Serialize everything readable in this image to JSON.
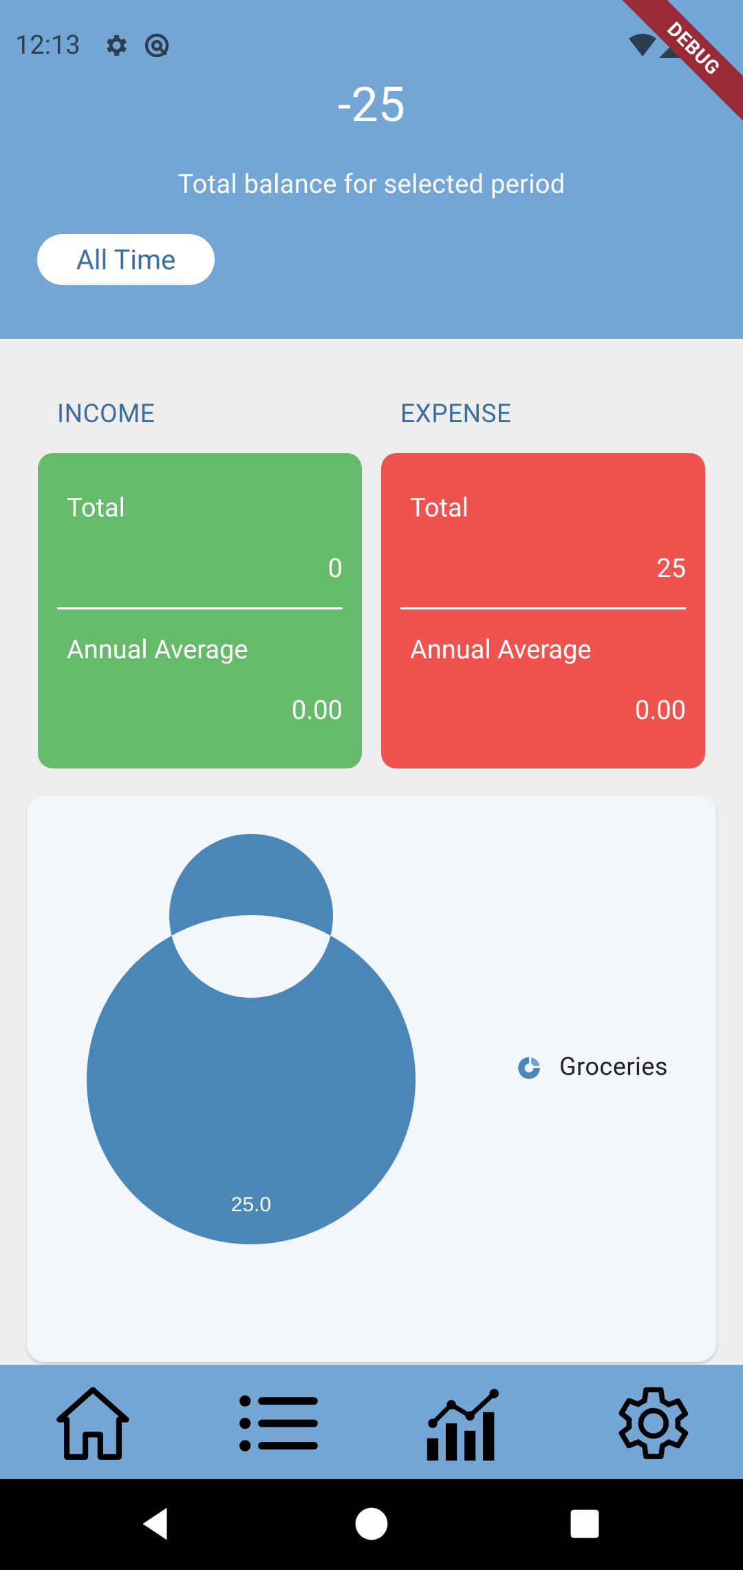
{
  "status_bar": {
    "time": "12:13",
    "icons": [
      "gear-icon",
      "at-sign-icon",
      "wifi-icon",
      "signal-icon",
      "battery-icon"
    ],
    "debug_banner": "DEBUG"
  },
  "header": {
    "balance": "-25",
    "caption": "Total balance for selected period",
    "period_button": "All Time",
    "color": "#73a5d5"
  },
  "income": {
    "title": "INCOME",
    "total_label": "Total",
    "total_value": "0",
    "average_label": "Annual Average",
    "average_value": "0.00",
    "color": "#66bb6a"
  },
  "expense": {
    "title": "EXPENSE",
    "total_label": "Total",
    "total_value": "25",
    "average_label": "Annual Average",
    "average_value": "0.00",
    "color": "#ef5350"
  },
  "chart_data": {
    "type": "pie",
    "donut": true,
    "categories": [
      "Groceries"
    ],
    "values": [
      25.0
    ],
    "data_labels": [
      "25.0"
    ],
    "colors": [
      "#4a86b8"
    ],
    "legend": {
      "entries": [
        "Groceries"
      ],
      "placement": "right"
    }
  },
  "bottom_nav": {
    "items": [
      "home-icon",
      "list-icon",
      "chart-icon",
      "settings-icon"
    ]
  },
  "system_nav": {
    "items": [
      "back-icon",
      "home-circle-icon",
      "recents-icon"
    ]
  }
}
